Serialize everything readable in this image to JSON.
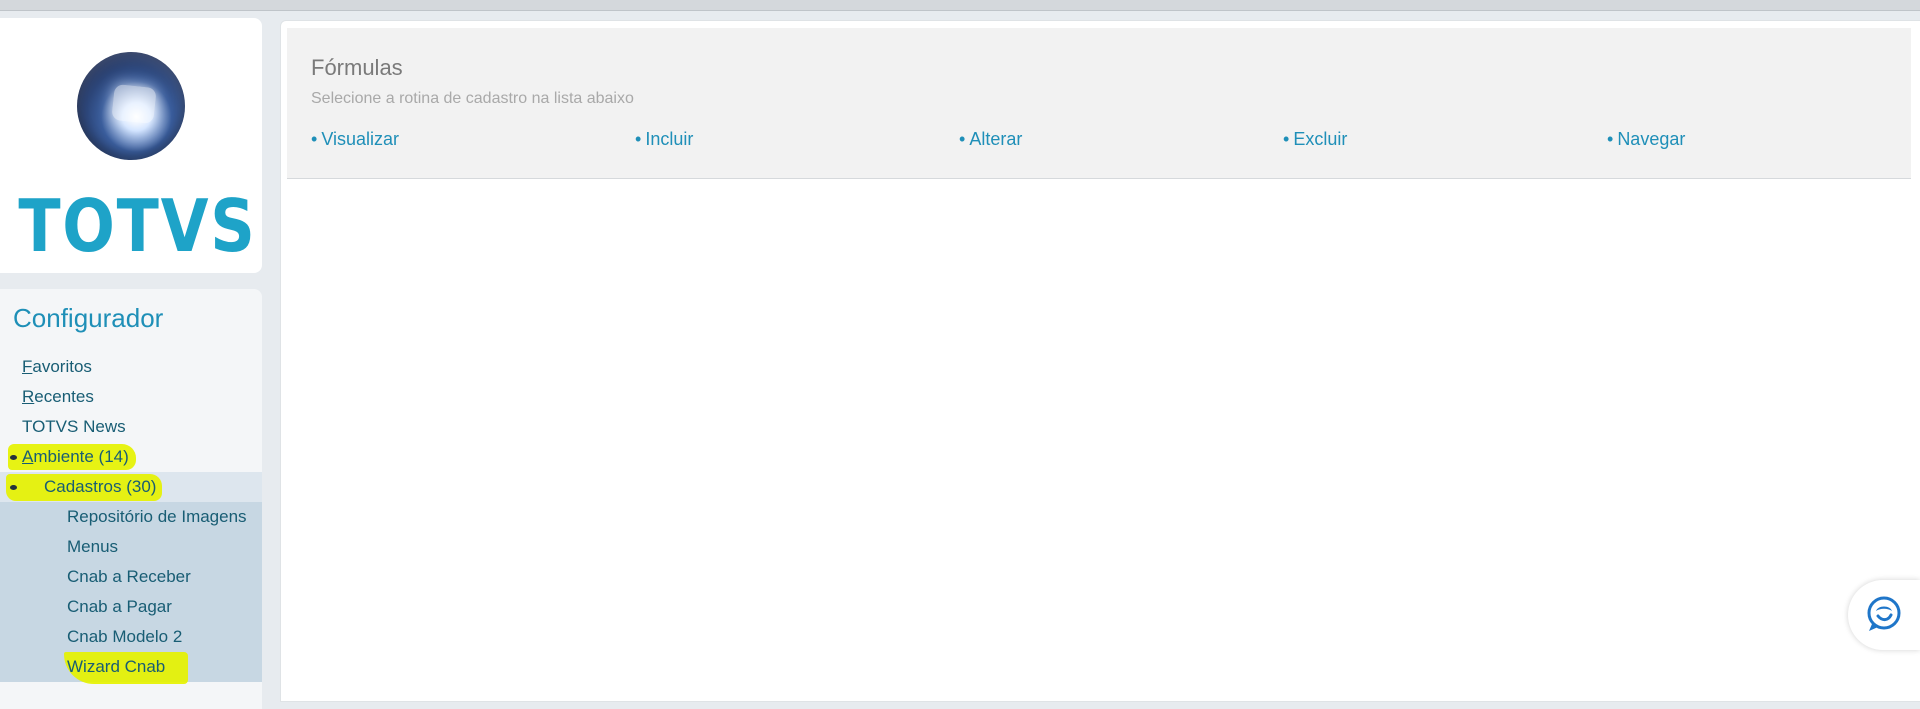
{
  "brand": {
    "logo_text": "TOTVS",
    "colors": {
      "accent": "#1ea3c8",
      "link": "#185d74",
      "highlight": "#e5f200"
    }
  },
  "sidebar": {
    "title": "Configurador",
    "items": [
      {
        "label_first": "F",
        "label_rest": "avoritos",
        "level": 0
      },
      {
        "label_first": "R",
        "label_rest": "ecentes",
        "level": 0
      },
      {
        "label": "TOTVS News",
        "level": 0
      },
      {
        "label_first": "A",
        "label_rest": "mbiente (14)",
        "level": 0,
        "expanded": true,
        "highlighted": true
      },
      {
        "label": "Cadastros (30)",
        "level": 1,
        "expanded": true,
        "highlighted": true
      },
      {
        "label": "Repositório de Imagens",
        "level": 2
      },
      {
        "label": "Menus",
        "level": 2
      },
      {
        "label": "Cnab a Receber",
        "level": 2
      },
      {
        "label": "Cnab a Pagar",
        "level": 2
      },
      {
        "label": "Cnab Modelo 2",
        "level": 2
      },
      {
        "label": "Wizard Cnab",
        "level": 2,
        "highlighted": true
      }
    ]
  },
  "main": {
    "title": "Fórmulas",
    "subtitle": "Selecione a rotina de cadastro na lista abaixo",
    "bullet": "•",
    "actions": [
      {
        "label": "Visualizar"
      },
      {
        "label": "Incluir"
      },
      {
        "label": "Alterar"
      },
      {
        "label": "Excluir"
      },
      {
        "label": "Navegar"
      }
    ]
  },
  "chat": {
    "icon": "chat-bubble-icon"
  }
}
